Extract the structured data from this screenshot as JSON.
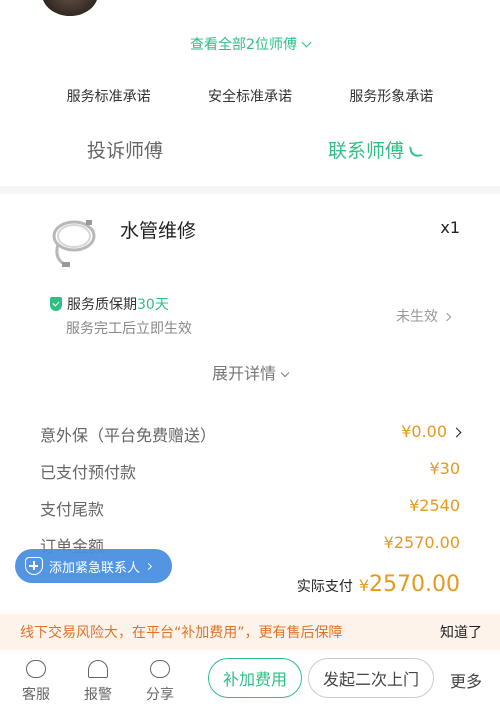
{
  "master": {
    "view_all": "查看全部2位师傅",
    "promises": [
      "服务标准承诺",
      "安全标准承诺",
      "服务形象承诺"
    ],
    "complain": "投诉师傅",
    "contact": "联系师傅"
  },
  "item": {
    "name": "水管维修",
    "qty": "x1",
    "image_icon": "hose-icon"
  },
  "warranty": {
    "title": "服务质保期",
    "days": "30天",
    "sub": "服务完工后立即生效",
    "status": "未生效"
  },
  "expand": "展开详情",
  "fees": [
    {
      "label": "意外保（平台免费赠送）",
      "value": "¥0.00"
    },
    {
      "label": "已支付预付款",
      "value": "¥30"
    },
    {
      "label": "支付尾款",
      "value": "¥2540"
    },
    {
      "label": "订单金额",
      "value": "¥2570.00"
    }
  ],
  "paid": {
    "label": "实际支付",
    "symbol": "¥",
    "amount": "2570.00"
  },
  "emergency": "添加紧急联系人",
  "risk": {
    "message": "线下交易风险大，在平台“补加费用”，更有售后保障",
    "ok": "知道了"
  },
  "bottom_nav": {
    "service": "客服",
    "alarm": "报警",
    "share": "分享",
    "add_fee": "补加费用",
    "second_visit": "发起二次上门",
    "more": "更多"
  },
  "colors": {
    "accent": "#2fbf84",
    "price": "#e69a1c",
    "warning": "#e0732a",
    "emergency_bg": "#4a90e2"
  }
}
